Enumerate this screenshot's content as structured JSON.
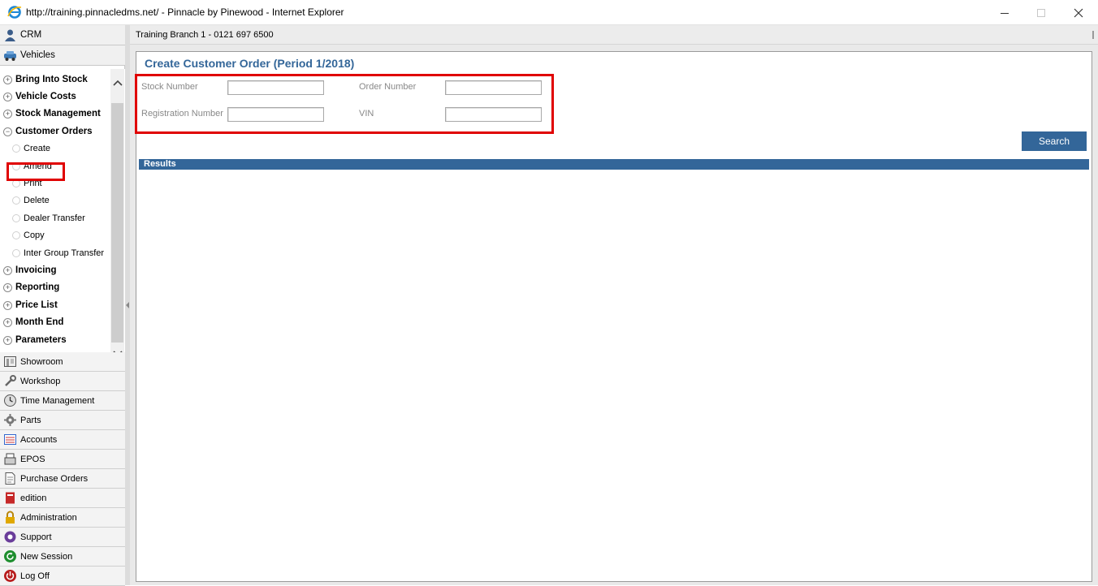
{
  "window": {
    "title": "http://training.pinnacledms.net/ - Pinnacle by Pinewood - Internet Explorer"
  },
  "sidebar": {
    "top_modules": [
      {
        "label": "CRM",
        "icon": "person-icon"
      },
      {
        "label": "Vehicles",
        "icon": "car-icon"
      }
    ],
    "tree": [
      {
        "label": "Bring Into Stock",
        "state": "collapsed"
      },
      {
        "label": "Vehicle Costs",
        "state": "collapsed"
      },
      {
        "label": "Stock Management",
        "state": "collapsed"
      },
      {
        "label": "Customer Orders",
        "state": "expanded"
      },
      {
        "label": "Invoicing",
        "state": "collapsed"
      },
      {
        "label": "Reporting",
        "state": "collapsed"
      },
      {
        "label": "Price List",
        "state": "collapsed"
      },
      {
        "label": "Month End",
        "state": "collapsed"
      },
      {
        "label": "Parameters",
        "state": "collapsed"
      }
    ],
    "customer_orders_children": [
      {
        "label": "Create"
      },
      {
        "label": "Amend"
      },
      {
        "label": "Print"
      },
      {
        "label": "Delete"
      },
      {
        "label": "Dealer Transfer"
      },
      {
        "label": "Copy"
      },
      {
        "label": "Inter Group Transfer"
      }
    ],
    "bottom_modules": [
      {
        "label": "Showroom",
        "icon": "showroom-icon"
      },
      {
        "label": "Workshop",
        "icon": "wrench-icon"
      },
      {
        "label": "Time Management",
        "icon": "clock-icon"
      },
      {
        "label": "Parts",
        "icon": "gear-icon"
      },
      {
        "label": "Accounts",
        "icon": "ledger-icon"
      },
      {
        "label": "EPOS",
        "icon": "till-icon"
      },
      {
        "label": "Purchase Orders",
        "icon": "document-icon"
      },
      {
        "label": "edition",
        "icon": "book-icon"
      },
      {
        "label": "Administration",
        "icon": "padlock-icon"
      },
      {
        "label": "Support",
        "icon": "support-icon"
      },
      {
        "label": "New Session",
        "icon": "refresh-icon"
      },
      {
        "label": "Log Off",
        "icon": "power-icon"
      }
    ]
  },
  "main": {
    "branch": "Training Branch 1 - 0121 697 6500",
    "page_title": "Create Customer Order (Period 1/2018)",
    "form": {
      "stock_number_label": "Stock Number",
      "stock_number_value": "",
      "order_number_label": "Order Number",
      "order_number_value": "",
      "registration_label": "Registration Number",
      "registration_value": "",
      "vin_label": "VIN",
      "vin_value": ""
    },
    "search_label": "Search",
    "results_label": "Results"
  },
  "colors": {
    "accent": "#336699",
    "highlight": "#e00000"
  }
}
